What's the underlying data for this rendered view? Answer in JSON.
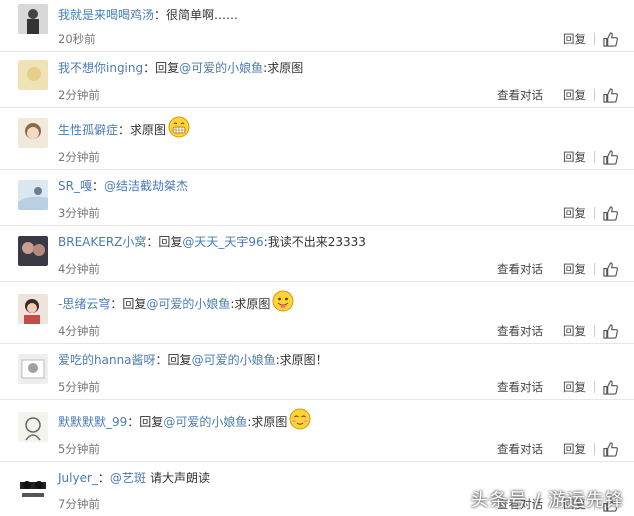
{
  "comments": [
    {
      "username": "我就是来喝喝鸡汤",
      "separator": "：",
      "text": "很简单啊……",
      "time": "20秒前",
      "reply": "回复"
    },
    {
      "username": "我不想你inging",
      "separator": "：",
      "reply_prefix": "回复",
      "mention": "@可爱的小娘鱼",
      "text": ":求原图",
      "time": "2分钟前",
      "view_convo": "查看对话",
      "reply": "回复"
    },
    {
      "username": "生性孤僻症",
      "separator": "：",
      "text": "求原图",
      "emoji": "grin-emoji",
      "time": "2分钟前",
      "reply": "回复"
    },
    {
      "username": "SR_嘎",
      "separator": "：",
      "mention": "@结洁截劫桀杰",
      "time": "3分钟前",
      "reply": "回复"
    },
    {
      "username": "BREAKERZ小窝",
      "separator": "：",
      "reply_prefix": "回复",
      "mention": "@天天_天宇96",
      "text": ":我读不出来23333",
      "time": "4分钟前",
      "view_convo": "查看对话",
      "reply": "回复"
    },
    {
      "username": "-思绪云穹",
      "separator": "：",
      "reply_prefix": "回复",
      "mention": "@可爱的小娘鱼",
      "text": ":求原图",
      "emoji": "tongue-emoji",
      "time": "4分钟前",
      "view_convo": "查看对话",
      "reply": "回复"
    },
    {
      "username": "爱吃的hanna酱呀",
      "separator": "：",
      "reply_prefix": "回复",
      "mention": "@可爱的小娘鱼",
      "text": ":求原图！",
      "time": "5分钟前",
      "view_convo": "查看对话",
      "reply": "回复"
    },
    {
      "username": "默默默默_99",
      "separator": "：",
      "reply_prefix": "回复",
      "mention": "@可爱的小娘鱼",
      "text": ":求原图",
      "emoji": "blush-emoji",
      "time": "5分钟前",
      "view_convo": "查看对话",
      "reply": "回复"
    },
    {
      "username": "Julyer_",
      "separator": "：",
      "mention": "@艺斑",
      "text": "请大声朗读",
      "time": "7分钟前",
      "view_convo": "查看对话",
      "reply": "回复"
    }
  ],
  "watermark": "头条号 / 游运先锋",
  "colors": {
    "link": "#4a7bb7",
    "text": "#333333",
    "meta": "#777777",
    "divider": "#e6e6e6"
  }
}
